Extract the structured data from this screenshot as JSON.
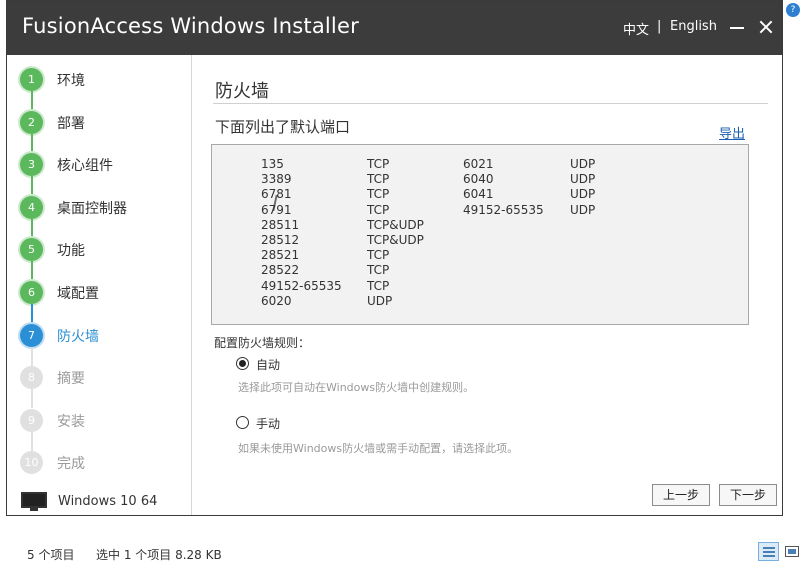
{
  "window": {
    "title": "FusionAccess Windows Installer",
    "lang_zh": "中文",
    "lang_separator": "|",
    "lang_en": "English"
  },
  "sidebar": {
    "steps": [
      {
        "num": "1",
        "label": "环境",
        "state": "done"
      },
      {
        "num": "2",
        "label": "部署",
        "state": "done"
      },
      {
        "num": "3",
        "label": "核心组件",
        "state": "done"
      },
      {
        "num": "4",
        "label": "桌面控制器",
        "state": "done"
      },
      {
        "num": "5",
        "label": "功能",
        "state": "done"
      },
      {
        "num": "6",
        "label": "域配置",
        "state": "done"
      },
      {
        "num": "7",
        "label": "防火墙",
        "state": "active"
      },
      {
        "num": "8",
        "label": "摘要",
        "state": "todo"
      },
      {
        "num": "9",
        "label": "安装",
        "state": "todo"
      },
      {
        "num": "10",
        "label": "完成",
        "state": "todo"
      }
    ],
    "os_label": "Windows 10 64"
  },
  "main": {
    "page_title": "防火墙",
    "ports_heading": "下面列出了默认端口",
    "export_link": "导出",
    "ports_left": [
      {
        "port": "135",
        "protocol": "TCP"
      },
      {
        "port": "3389",
        "protocol": "TCP"
      },
      {
        "port": "6781",
        "protocol": "TCP"
      },
      {
        "port": "6791",
        "protocol": "TCP"
      },
      {
        "port": "28511",
        "protocol": "TCP&UDP"
      },
      {
        "port": "28512",
        "protocol": "TCP&UDP"
      },
      {
        "port": "28521",
        "protocol": "TCP"
      },
      {
        "port": "28522",
        "protocol": "TCP"
      },
      {
        "port": "49152-65535",
        "protocol": "TCP"
      },
      {
        "port": "6020",
        "protocol": "UDP"
      }
    ],
    "ports_right": [
      {
        "port": "6021",
        "protocol": "UDP"
      },
      {
        "port": "6040",
        "protocol": "UDP"
      },
      {
        "port": "6041",
        "protocol": "UDP"
      },
      {
        "port": "49152-65535",
        "protocol": "UDP"
      }
    ],
    "rules_label": "配置防火墙规则：",
    "option_auto": {
      "label": "自动",
      "desc": "选择此项可自动在Windows防火墙中创建规则。",
      "checked": true
    },
    "option_manual": {
      "label": "手动",
      "desc": "如果未使用Windows防火墙或需手动配置，请选择此项。",
      "checked": false
    },
    "prev_button": "上一步",
    "next_button": "下一步"
  },
  "statusbar": {
    "item_count": "5 个项目",
    "selection": "选中 1 个项目  8.28 KB"
  },
  "colors": {
    "titlebar": "#3c3c3c",
    "step_done": "#5cb85c",
    "step_active": "#2b8fd6",
    "step_todo": "#e0e0e0",
    "link": "#1a5fb4"
  }
}
